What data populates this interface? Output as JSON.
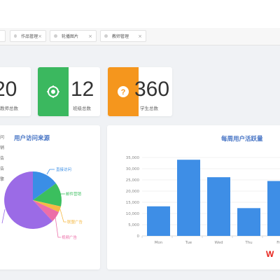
{
  "tabs": [
    {
      "label": "作品管理"
    },
    {
      "label": "轮播图片"
    },
    {
      "label": "教师管理"
    }
  ],
  "stats": [
    {
      "value": "20",
      "label": "教师总数"
    },
    {
      "value": "12",
      "label": "班级总数",
      "icon": "target-icon",
      "color": "#3bb85f"
    },
    {
      "value": "360",
      "label": "学生总数",
      "icon": "question-icon",
      "color": "#f5961d"
    }
  ],
  "pie": {
    "title": "用户访问来源",
    "legend_visible": [
      "问",
      "销",
      "告",
      "告",
      "擎"
    ],
    "labels": [
      "直接访问",
      "邮件营销",
      "联盟广告",
      "视频广告"
    ],
    "colors": [
      "#3a8ee6",
      "#3bbf5e",
      "#f5b945",
      "#ec6ea8",
      "#9b6be6"
    ]
  },
  "chart_data": {
    "type": "bar",
    "title": "每周用户活跃量",
    "categories": [
      "Mon",
      "Tue",
      "Wed",
      "Thu",
      "Fri"
    ],
    "values": [
      13200,
      34000,
      26200,
      12400,
      24500
    ],
    "ylim": [
      0,
      35000
    ],
    "yticks": [
      "0",
      "5,000",
      "10,000",
      "15,000",
      "20,000",
      "25,000",
      "30,000",
      "35,000"
    ],
    "color": "#3e8ee6"
  },
  "watermark": "W"
}
